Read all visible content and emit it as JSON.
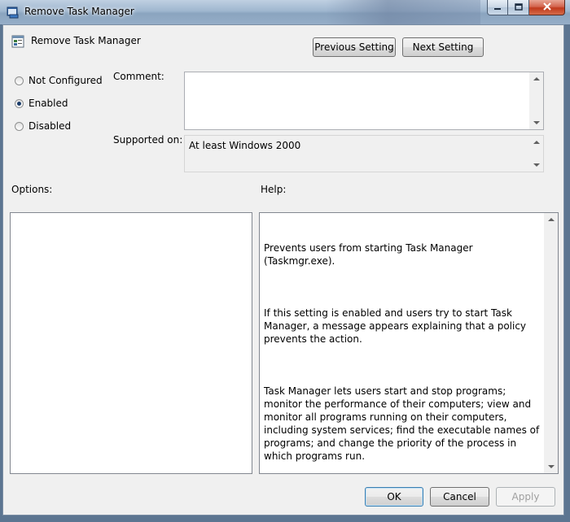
{
  "window": {
    "title": "Remove Task Manager"
  },
  "header": {
    "setting_name": "Remove Task Manager",
    "previous_button_label": "Previous Setting",
    "next_button_label": "Next Setting"
  },
  "state": {
    "options": [
      {
        "label": "Not Configured",
        "checked": false
      },
      {
        "label": "Enabled",
        "checked": true
      },
      {
        "label": "Disabled",
        "checked": false
      }
    ]
  },
  "comment": {
    "label": "Comment:",
    "value": ""
  },
  "supported": {
    "label": "Supported on:",
    "value": "At least Windows 2000"
  },
  "options_panel": {
    "label": "Options:"
  },
  "help_panel": {
    "label": "Help:",
    "paragraphs": [
      "Prevents users from starting Task Manager (Taskmgr.exe).",
      "If this setting is enabled and users try to start Task Manager, a message appears explaining that a policy prevents the action.",
      "Task Manager lets users start and stop programs; monitor the performance of their computers; view and monitor all programs running on their computers, including system services; find the executable names of programs; and change the priority of the process in which programs run."
    ]
  },
  "footer": {
    "ok_label": "OK",
    "cancel_label": "Cancel",
    "apply_label": "Apply"
  },
  "colors": {
    "accent_border": "#3c7fb1",
    "close_button": "#c0391c",
    "radio_dot": "#1a3c6a"
  },
  "icons": {
    "title": "policy-window-icon",
    "setting": "policy-setting-icon"
  }
}
